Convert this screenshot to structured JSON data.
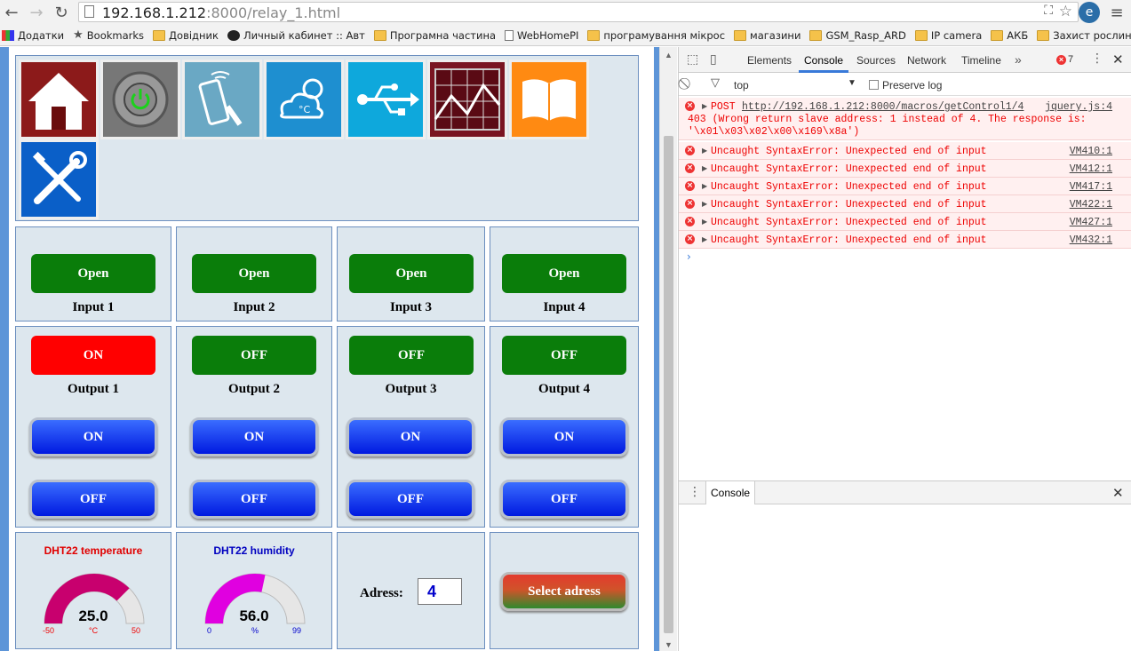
{
  "browser": {
    "url_host": "192.168.1.212",
    "url_rest": ":8000/relay_1.html",
    "bookmarks": [
      "Додатки",
      "Bookmarks",
      "Довідник",
      "Личный кабинет :: Авт",
      "Програмна частина",
      "WebHomePI",
      "програмування мікрос",
      "магазини",
      "GSM_Rasp_ARD",
      "IP camera",
      "АКБ",
      "Захист рослин"
    ]
  },
  "page": {
    "icons": [
      "home-icon",
      "power-icon",
      "remote-icon",
      "weather-icon",
      "usb-icon",
      "chart-icon",
      "book-icon",
      "tools-icon"
    ],
    "inputs": [
      {
        "button": "Open",
        "label": "Input 1"
      },
      {
        "button": "Open",
        "label": "Input 2"
      },
      {
        "button": "Open",
        "label": "Input 3"
      },
      {
        "button": "Open",
        "label": "Input 4"
      }
    ],
    "outputs": [
      {
        "state": "ON",
        "label": "Output 1",
        "state_color": "#ff0000",
        "on": "ON",
        "off": "OFF"
      },
      {
        "state": "OFF",
        "label": "Output 2",
        "state_color": "#0a7d0a",
        "on": "ON",
        "off": "OFF"
      },
      {
        "state": "OFF",
        "label": "Output 3",
        "state_color": "#0a7d0a",
        "on": "ON",
        "off": "OFF"
      },
      {
        "state": "OFF",
        "label": "Output 4",
        "state_color": "#0a7d0a",
        "on": "ON",
        "off": "OFF"
      }
    ],
    "temperature": {
      "title": "DHT22 temperature",
      "value": "25.0",
      "unit": "°C",
      "min": "-50",
      "max": "50",
      "fraction": 0.75,
      "color": "#c8006e",
      "title_color": "#e00000"
    },
    "humidity": {
      "title": "DHT22 humidity",
      "value": "56.0",
      "unit": "%",
      "min": "0",
      "max": "99",
      "fraction": 0.566,
      "color": "#e000e0",
      "title_color": "#0000c0"
    },
    "address": {
      "label": "Adress:",
      "value": "4",
      "button": "Select adress"
    }
  },
  "devtools": {
    "tabs": [
      "Elements",
      "Console",
      "Sources",
      "Network",
      "Timeline"
    ],
    "error_count": "7",
    "context": "top",
    "preserve_log": "Preserve log",
    "post": {
      "method": "POST",
      "url": "http://192.168.1.212:8000/macros/getControl1/4",
      "source": "jquery.js:4",
      "line2": "403 (Wrong return slave address: 1 instead of 4. The response is:",
      "line3": "'\\x01\\x03\\x02\\x00\\x169\\x8a')"
    },
    "errors": [
      {
        "text": "Uncaught SyntaxError: Unexpected end of input",
        "source": "VM410:1"
      },
      {
        "text": "Uncaught SyntaxError: Unexpected end of input",
        "source": "VM412:1"
      },
      {
        "text": "Uncaught SyntaxError: Unexpected end of input",
        "source": "VM417:1"
      },
      {
        "text": "Uncaught SyntaxError: Unexpected end of input",
        "source": "VM422:1"
      },
      {
        "text": "Uncaught SyntaxError: Unexpected end of input",
        "source": "VM427:1"
      },
      {
        "text": "Uncaught SyntaxError: Unexpected end of input",
        "source": "VM432:1"
      }
    ],
    "drawer_tab": "Console"
  }
}
